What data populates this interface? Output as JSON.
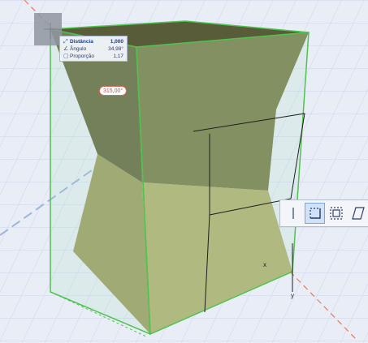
{
  "tracker": {
    "rows": [
      {
        "icon": "distance-icon",
        "label": "Distância",
        "value": "1,000"
      },
      {
        "icon": "angle-icon",
        "label": "Ângulo",
        "value": "34,98°"
      },
      {
        "icon": "proportion-icon",
        "label": "Proporção",
        "value": "1,17"
      }
    ]
  },
  "angle_badge": "315,00°",
  "axes": {
    "x": "x",
    "y": "y"
  },
  "palette": {
    "buttons": [
      "single-line-icon",
      "rectangle-corner-icon",
      "rectangle-center-icon",
      "parallelogram-icon"
    ],
    "selected_index": 1
  },
  "colors": {
    "solid_light": "#a8a666",
    "solid_dark": "#595c38",
    "bounding_box": "#4fc24f",
    "angle_line": "#e8795e",
    "guide_line": "#9fb4de",
    "background": "#e9edf5"
  }
}
